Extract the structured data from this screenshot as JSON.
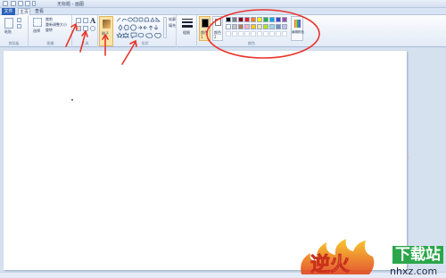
{
  "app": {
    "title": "无标题 - 画图"
  },
  "tabs": [
    {
      "label": "文件"
    },
    {
      "label": "主页"
    },
    {
      "label": "查看"
    }
  ],
  "ribbon": {
    "clipboard": {
      "paste_label": "粘贴",
      "group_label": "剪贴板"
    },
    "image": {
      "select_label": "选择",
      "crop_label": "裁剪",
      "resize_label": "重新调整大小",
      "rotate_label": "旋转",
      "group_label": "图像"
    },
    "tools": {
      "group_label": "工具"
    },
    "brushes": {
      "label": "刷子"
    },
    "shapes": {
      "outline_label": "轮廓",
      "fill_label": "填充",
      "group_label": "形状"
    },
    "size": {
      "label": "粗细"
    },
    "colors": {
      "color1_label": "颜色 1",
      "color2_label": "颜色 2",
      "edit_label": "编辑颜色",
      "group_label": "颜色"
    }
  },
  "palette": {
    "row1": [
      "#000000",
      "#7f7f7f",
      "#880015",
      "#ed1c24",
      "#ff7f27",
      "#fff200",
      "#22b14c",
      "#00a2e8",
      "#3f48cc",
      "#a349a4"
    ],
    "row2": [
      "#ffffff",
      "#c3c3c3",
      "#b97a57",
      "#ffaec9",
      "#ffc90e",
      "#efe4b0",
      "#b5e61d",
      "#99d9ea",
      "#7092be",
      "#c8bfe7"
    ],
    "row3": [
      "#ffffff",
      "#ffffff",
      "#ffffff",
      "#ffffff",
      "#ffffff",
      "#ffffff",
      "#ffffff",
      "#ffffff",
      "#ffffff",
      "#ffffff"
    ],
    "color1": "#000000",
    "color2": "#ffffff"
  },
  "watermark": {
    "brand_text": "逆火",
    "download_text": "下载站",
    "url": "nhxz.com"
  }
}
